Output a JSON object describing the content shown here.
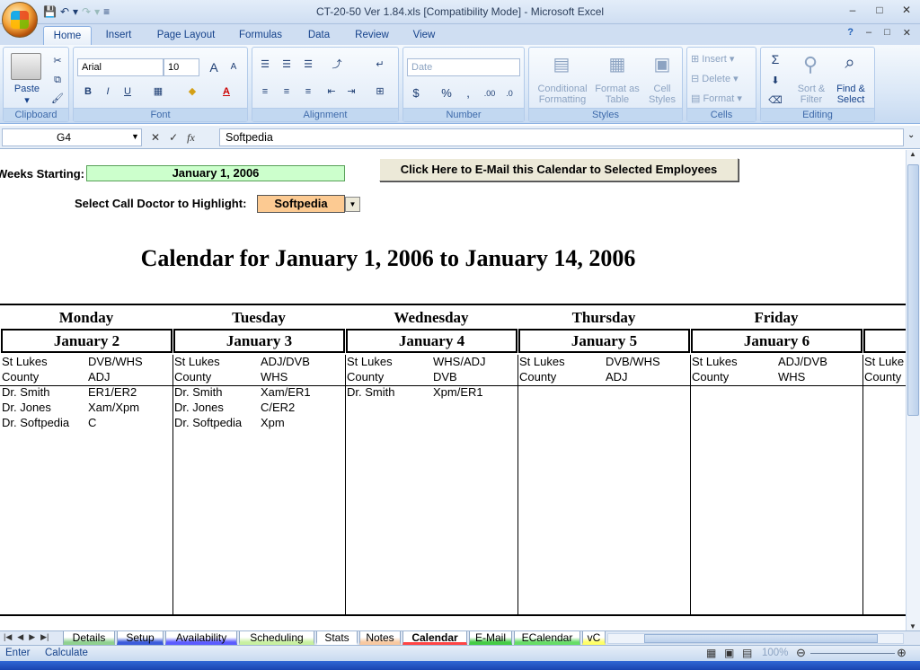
{
  "window": {
    "title": "CT-20-50 Ver 1.84.xls  [Compatibility Mode] - Microsoft Excel",
    "controls": [
      "–",
      "□",
      "✕"
    ]
  },
  "ribbon_tabs": [
    "Home",
    "Insert",
    "Page Layout",
    "Formulas",
    "Data",
    "Review",
    "View"
  ],
  "active_tab": "Home",
  "ribbon": {
    "clipboard": {
      "label": "Clipboard",
      "paste": "Paste"
    },
    "font": {
      "label": "Font",
      "font_name": "Arial",
      "font_size": "10",
      "bold": "B",
      "italic": "I",
      "underline": "U",
      "grow": "A",
      "shrink": "A",
      "font_color": "A"
    },
    "alignment": {
      "label": "Alignment"
    },
    "number": {
      "label": "Number",
      "format": "Date",
      "currency": "$",
      "percent": "%",
      "comma": ",",
      "inc_dec": ".00",
      "dec_dec": ".0"
    },
    "styles": {
      "label": "Styles",
      "conditional": "Conditional Formatting",
      "as_table": "Format as Table",
      "cell_styles": "Cell Styles"
    },
    "cells": {
      "label": "Cells",
      "insert": "Insert",
      "delete": "Delete",
      "format": "Format"
    },
    "editing": {
      "label": "Editing",
      "sum": "Σ",
      "sort": "Sort & Filter",
      "find": "Find & Select"
    }
  },
  "formula_bar": {
    "name_box": "G4",
    "fx": "fx",
    "value": "Softpedia"
  },
  "sheet": {
    "weeks_label": "Weeks Starting:",
    "weeks_value": "January 1, 2006",
    "email_button": "Click Here to E-Mail this Calendar to Selected Employees",
    "highlight_label": "Select Call Doctor to Highlight:",
    "highlight_value": "Softpedia",
    "calendar_title": "Calendar for January 1, 2006  to  January 14, 2006",
    "days": [
      {
        "name": "Monday",
        "date": "January 2",
        "rows": [
          [
            "St Lukes",
            "DVB/WHS"
          ],
          [
            "County",
            "ADJ"
          ],
          [
            "Dr. Smith",
            "ER1/ER2"
          ],
          [
            "Dr. Jones",
            "Xam/Xpm"
          ],
          [
            "Dr. Softpedia",
            "C"
          ]
        ]
      },
      {
        "name": "Tuesday",
        "date": "January 3",
        "rows": [
          [
            "St Lukes",
            "ADJ/DVB"
          ],
          [
            "County",
            "WHS"
          ],
          [
            "Dr. Smith",
            "Xam/ER1"
          ],
          [
            "Dr. Jones",
            "C/ER2"
          ],
          [
            "Dr. Softpedia",
            "Xpm"
          ]
        ]
      },
      {
        "name": "Wednesday",
        "date": "January 4",
        "rows": [
          [
            "St Lukes",
            "WHS/ADJ"
          ],
          [
            "County",
            "DVB"
          ],
          [
            "Dr. Smith",
            "Xpm/ER1"
          ]
        ]
      },
      {
        "name": "Thursday",
        "date": "January 5",
        "rows": [
          [
            "St Lukes",
            "DVB/WHS"
          ],
          [
            "County",
            "ADJ"
          ]
        ]
      },
      {
        "name": "Friday",
        "date": "January 6",
        "rows": [
          [
            "St Lukes",
            "ADJ/DVB"
          ],
          [
            "County",
            "WHS"
          ]
        ]
      },
      {
        "name": "Sa",
        "date": "Jan",
        "rows": [
          [
            "St Luke",
            ""
          ],
          [
            "County",
            ""
          ]
        ]
      }
    ]
  },
  "sheet_tabs": [
    {
      "label": "Details",
      "color": "#8fd18f"
    },
    {
      "label": "Setup",
      "color": "#3b5bdb"
    },
    {
      "label": "Availability",
      "color": "#5b5bff"
    },
    {
      "label": "Scheduling",
      "color": "#c8f0a0"
    },
    {
      "label": "Stats",
      "color": "#ffffff"
    },
    {
      "label": "Notes",
      "color": "#f8c8a0"
    },
    {
      "label": "Calendar",
      "color": "#ff4444"
    },
    {
      "label": "E-Mail",
      "color": "#44cc44"
    },
    {
      "label": "ECalendar",
      "color": "#66dd66"
    },
    {
      "label": "vC",
      "color": "#ffff66"
    }
  ],
  "active_sheet": "Calendar",
  "status_bar": {
    "mode": "Enter",
    "calc": "Calculate",
    "zoom": "100%"
  }
}
